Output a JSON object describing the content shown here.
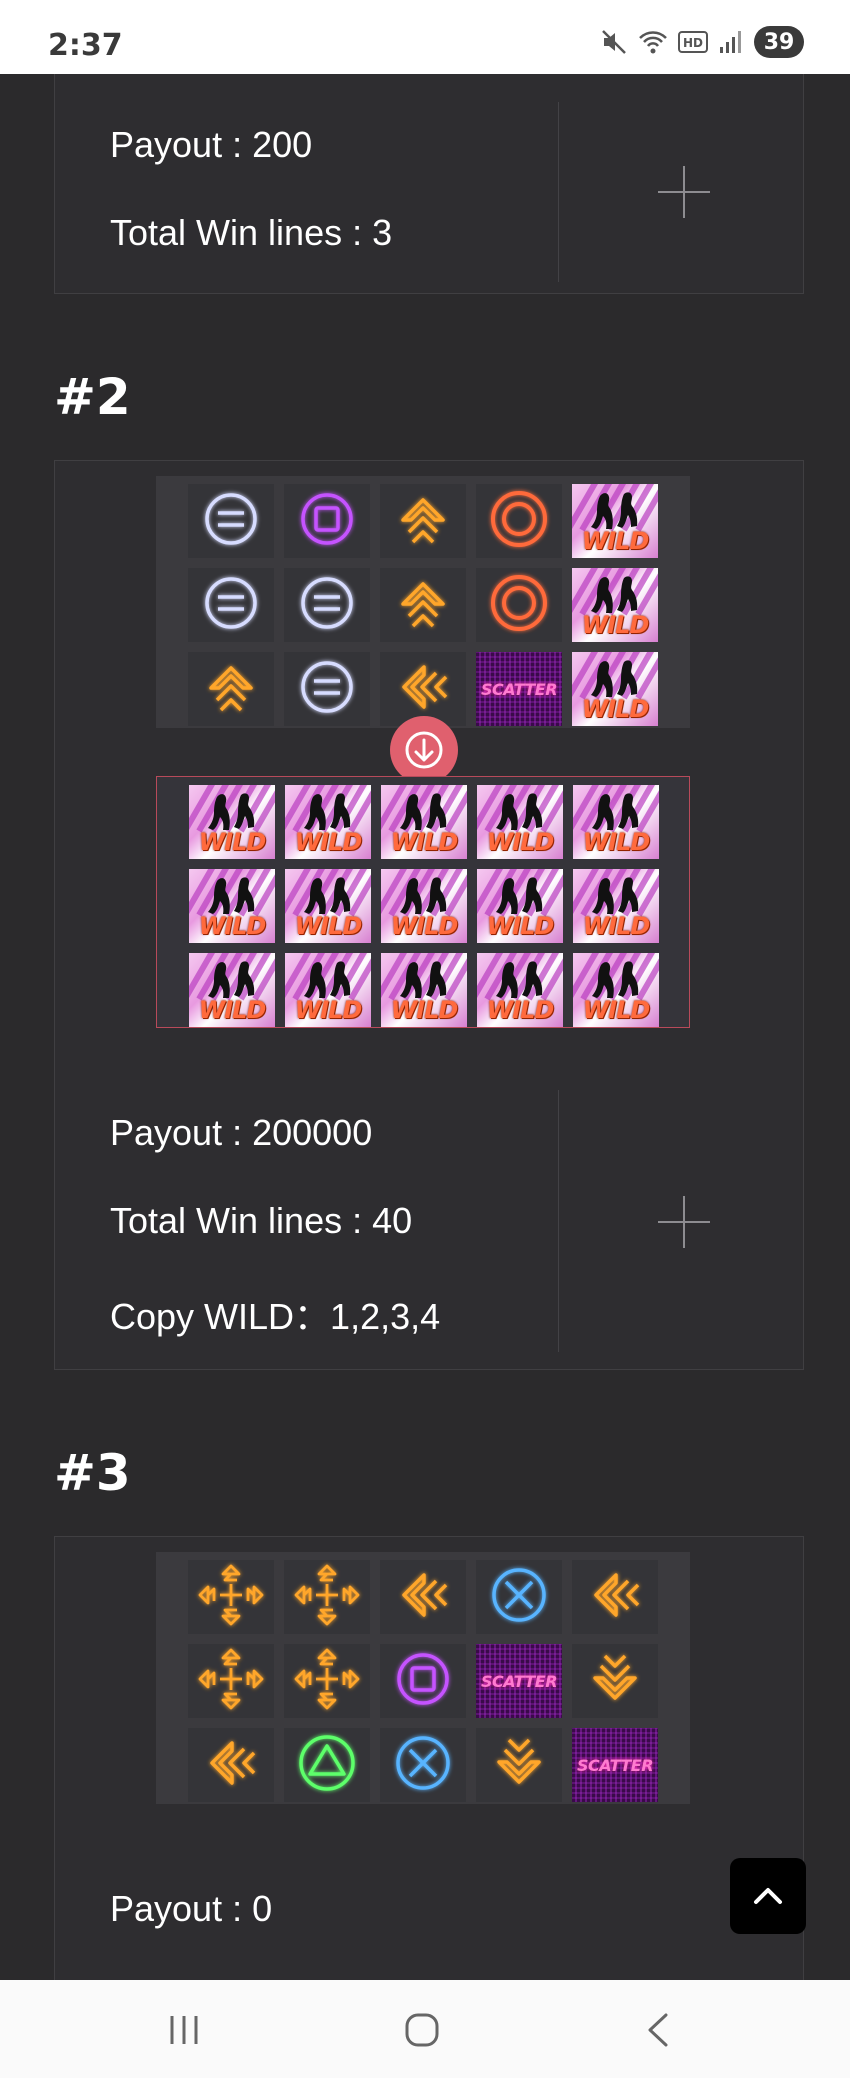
{
  "status_bar": {
    "time": "2:37",
    "battery": "39",
    "icons": [
      "mute-icon",
      "wifi-icon",
      "hd-icon",
      "signal-icon",
      "battery-icon"
    ]
  },
  "card1": {
    "payout": "Payout : 200",
    "win_lines": "Total Win lines : 3"
  },
  "card2": {
    "heading": "#2",
    "payout": "Payout : 200000",
    "win_lines": "Total Win lines : 40",
    "copy_wild": "Copy WILD：1,2,3,4",
    "before_grid": [
      [
        "circle-line",
        "square-purple",
        "chevron-up",
        "ring-red",
        "wild"
      ],
      [
        "circle-line",
        "circle-line",
        "chevron-up",
        "ring-red",
        "wild"
      ],
      [
        "chevron-up",
        "circle-line",
        "chevron-left",
        "scatter",
        "wild"
      ]
    ],
    "after_grid": [
      [
        "wild",
        "wild",
        "wild",
        "wild",
        "wild"
      ],
      [
        "wild",
        "wild",
        "wild",
        "wild",
        "wild"
      ],
      [
        "wild",
        "wild",
        "wild",
        "wild",
        "wild"
      ]
    ]
  },
  "card3": {
    "heading": "#3",
    "payout": "Payout : 0",
    "grid": [
      [
        "arrows4",
        "arrows4",
        "chevron-left",
        "cross-blue",
        "chevron-left"
      ],
      [
        "arrows4",
        "arrows4",
        "square-purple",
        "scatter",
        "chevron-down"
      ],
      [
        "chevron-left",
        "triangle-green",
        "cross-blue",
        "chevron-down",
        "scatter"
      ]
    ]
  },
  "symbol_labels": {
    "wild": "WILD",
    "scatter": "SCATTER"
  },
  "colors": {
    "background": "#2b2a2c",
    "accent_red": "#e0606e",
    "neon_orange": "#ffa62b",
    "neon_purple": "#c552ff",
    "neon_blue": "#58b4ff",
    "neon_green": "#5dff6a"
  },
  "nav": [
    "recent-apps-icon",
    "home-icon",
    "back-icon"
  ]
}
